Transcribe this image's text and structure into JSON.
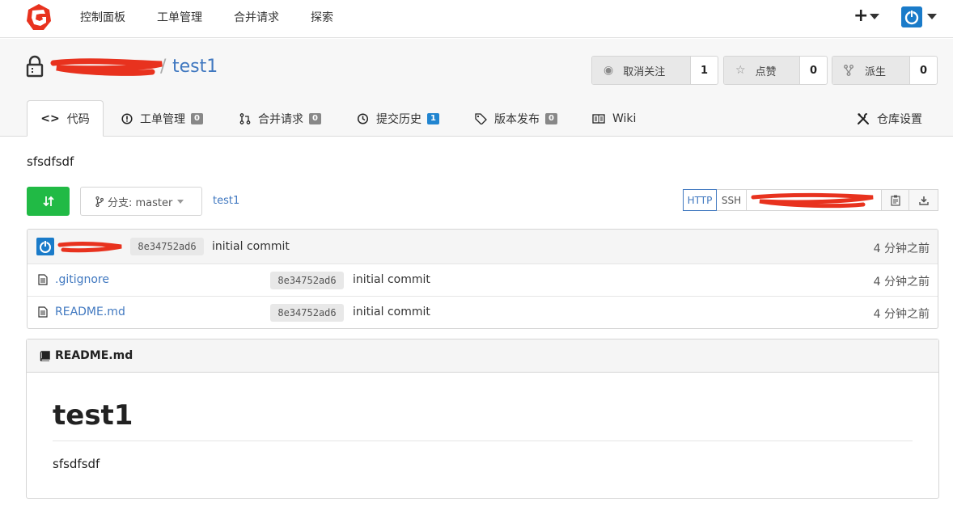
{
  "nav": {
    "links": [
      "控制面板",
      "工单管理",
      "合并请求",
      "探索"
    ],
    "plus": "+"
  },
  "repo": {
    "slash": "/",
    "name": "test1",
    "watch": {
      "label": "取消关注",
      "count": "1"
    },
    "star": {
      "label": "点赞",
      "count": "0"
    },
    "fork": {
      "label": "派生",
      "count": "0"
    }
  },
  "tabs": {
    "code": "代码",
    "issues": {
      "label": "工单管理",
      "count": "0"
    },
    "pulls": {
      "label": "合并请求",
      "count": "0"
    },
    "commits": {
      "label": "提交历史",
      "count": "1"
    },
    "releases": {
      "label": "版本发布",
      "count": "0"
    },
    "wiki": "Wiki",
    "settings": "仓库设置"
  },
  "description": "sfsdfsdf",
  "actions": {
    "branch_label": "分支: master",
    "breadcrumb": "test1",
    "http": "HTTP",
    "ssh": "SSH"
  },
  "latest_commit": {
    "sha": "8e34752ad6",
    "message": "initial commit",
    "time": "4 分钟之前"
  },
  "files": [
    {
      "name": ".gitignore",
      "sha": "8e34752ad6",
      "message": "initial commit",
      "time": "4 分钟之前"
    },
    {
      "name": "README.md",
      "sha": "8e34752ad6",
      "message": "initial commit",
      "time": "4 分钟之前"
    }
  ],
  "readme": {
    "filename": "README.md",
    "heading": "test1",
    "body": "sfsdfsdf"
  },
  "colors": {
    "accent": "#4078c0",
    "green": "#21ba45",
    "avatar": "#1a7bc9",
    "redaction": "#e8321e"
  }
}
